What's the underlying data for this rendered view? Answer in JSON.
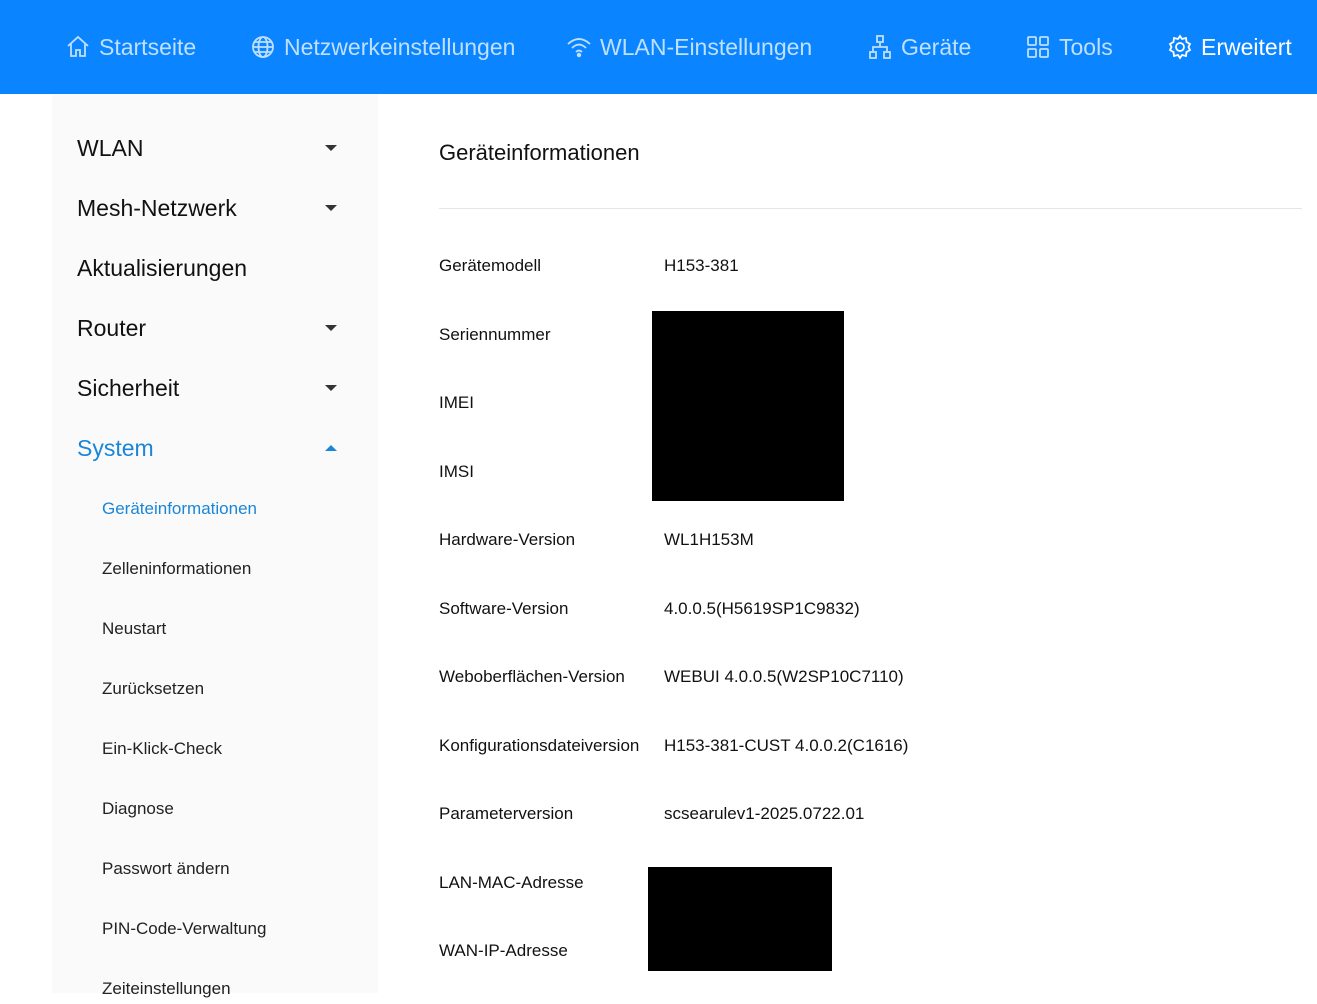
{
  "topnav": {
    "items": [
      {
        "label": "Startseite",
        "icon": "home-icon"
      },
      {
        "label": "Netzwerkeinstellungen",
        "icon": "globe-icon"
      },
      {
        "label": "WLAN-Einstellungen",
        "icon": "wifi-icon"
      },
      {
        "label": "Geräte",
        "icon": "devices-icon"
      },
      {
        "label": "Tools",
        "icon": "grid-icon"
      },
      {
        "label": "Erweitert",
        "icon": "gear-icon"
      }
    ],
    "active": "Erweitert",
    "colors": {
      "bar": "#0a84ff",
      "inactive_text": "#bfe0ff",
      "active_text": "#ffffff"
    }
  },
  "sidebar": {
    "sections": [
      {
        "label": "WLAN",
        "expandable": true,
        "expanded": false
      },
      {
        "label": "Mesh-Netzwerk",
        "expandable": true,
        "expanded": false
      },
      {
        "label": "Aktualisierungen",
        "expandable": false,
        "expanded": false
      },
      {
        "label": "Router",
        "expandable": true,
        "expanded": false
      },
      {
        "label": "Sicherheit",
        "expandable": true,
        "expanded": false
      },
      {
        "label": "System",
        "expandable": true,
        "expanded": true
      }
    ],
    "system_items": [
      "Geräteinformationen",
      "Zelleninformationen",
      "Neustart",
      "Zurücksetzen",
      "Ein-Klick-Check",
      "Diagnose",
      "Passwort ändern",
      "PIN-Code-Verwaltung",
      "Zeiteinstellungen"
    ],
    "active_item": "Geräteinformationen",
    "accent_color": "#1a86d8"
  },
  "main": {
    "title": "Geräteinformationen",
    "rows": [
      {
        "label": "Gerätemodell",
        "value": "H153-381"
      },
      {
        "label": "Seriennummer",
        "value": ""
      },
      {
        "label": "IMEI",
        "value": ""
      },
      {
        "label": "IMSI",
        "value": ""
      },
      {
        "label": "Hardware-Version",
        "value": "WL1H153M"
      },
      {
        "label": "Software-Version",
        "value": "4.0.0.5(H5619SP1C9832)"
      },
      {
        "label": "Weboberflächen-Version",
        "value": "WEBUI 4.0.0.5(W2SP10C7110)"
      },
      {
        "label": "Konfigurationsdateiversion",
        "value": "H153-381-CUST 4.0.0.2(C1616)"
      },
      {
        "label": "Parameterversion",
        "value": "scsearulev1-2025.0722.01"
      },
      {
        "label": "LAN-MAC-Adresse",
        "value": ""
      },
      {
        "label": "WAN-IP-Adresse",
        "value": ""
      }
    ]
  }
}
